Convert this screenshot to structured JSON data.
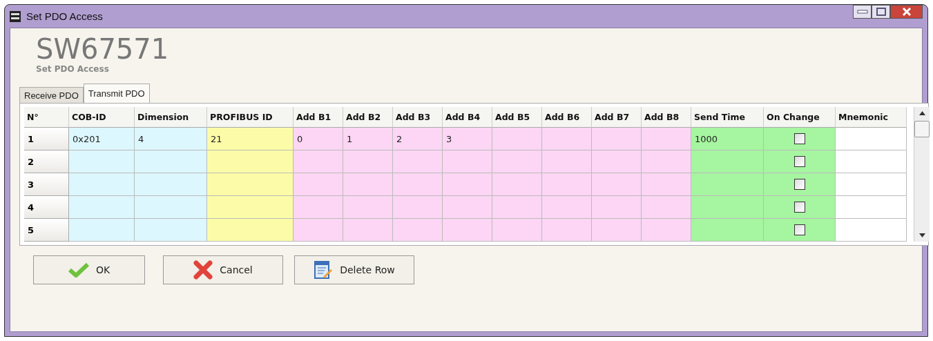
{
  "window": {
    "title": "Set PDO Access"
  },
  "header": {
    "title": "SW67571",
    "subtitle": "Set PDO Access"
  },
  "tabs": [
    {
      "label": "Receive PDO",
      "selected": false
    },
    {
      "label": "Transmit PDO",
      "selected": true
    }
  ],
  "table": {
    "columns": [
      {
        "label": "N°",
        "kind": "index"
      },
      {
        "label": "COB-ID",
        "kind": "text",
        "color": "#dcf7fd"
      },
      {
        "label": "Dimension",
        "kind": "text",
        "color": "#dcf7fd"
      },
      {
        "label": "PROFIBUS ID",
        "kind": "text",
        "color": "#fcfca8"
      },
      {
        "label": "Add B1",
        "kind": "text",
        "color": "#fcd6f4"
      },
      {
        "label": "Add B2",
        "kind": "text",
        "color": "#fcd6f4"
      },
      {
        "label": "Add B3",
        "kind": "text",
        "color": "#fcd6f4"
      },
      {
        "label": "Add B4",
        "kind": "text",
        "color": "#fcd6f4"
      },
      {
        "label": "Add B5",
        "kind": "text",
        "color": "#fcd6f4"
      },
      {
        "label": "Add B6",
        "kind": "text",
        "color": "#fcd6f4"
      },
      {
        "label": "Add B7",
        "kind": "text",
        "color": "#fcd6f4"
      },
      {
        "label": "Add B8",
        "kind": "text",
        "color": "#fcd6f4"
      },
      {
        "label": "Send Time",
        "kind": "text",
        "color": "#a6f5a0"
      },
      {
        "label": "On Change",
        "kind": "checkbox",
        "color": "#a6f5a0"
      },
      {
        "label": "Mnemonic",
        "kind": "text",
        "color": "#ffffff"
      }
    ],
    "rows": [
      {
        "cells": [
          "1",
          "0x201",
          "4",
          "21",
          "0",
          "1",
          "2",
          "3",
          "",
          "",
          "",
          "",
          "1000",
          false,
          ""
        ]
      },
      {
        "cells": [
          "2",
          "",
          "",
          "",
          "",
          "",
          "",
          "",
          "",
          "",
          "",
          "",
          "",
          false,
          ""
        ]
      },
      {
        "cells": [
          "3",
          "",
          "",
          "",
          "",
          "",
          "",
          "",
          "",
          "",
          "",
          "",
          "",
          false,
          ""
        ]
      },
      {
        "cells": [
          "4",
          "",
          "",
          "",
          "",
          "",
          "",
          "",
          "",
          "",
          "",
          "",
          "",
          false,
          ""
        ]
      },
      {
        "cells": [
          "5",
          "",
          "",
          "",
          "",
          "",
          "",
          "",
          "",
          "",
          "",
          "",
          "",
          false,
          ""
        ]
      }
    ]
  },
  "buttons": [
    {
      "label": "OK",
      "kind": "ok"
    },
    {
      "label": "Cancel",
      "kind": "cancel"
    },
    {
      "label": "Delete Row",
      "kind": "delete"
    }
  ]
}
